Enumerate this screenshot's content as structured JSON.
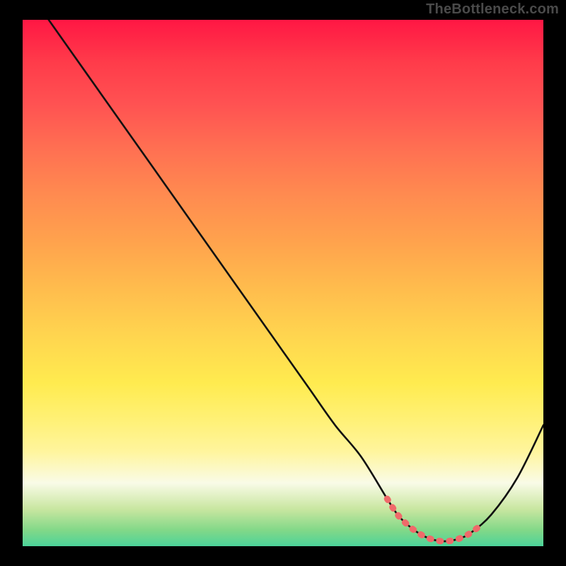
{
  "attribution": "TheBottleneck.com",
  "colors": {
    "background": "#000000",
    "watermark": "#4a4a4a",
    "curve": "#111111",
    "highlight": "#ef6a6a"
  },
  "chart_data": {
    "type": "line",
    "title": "",
    "xlabel": "",
    "ylabel": "",
    "xlim": [
      0,
      100
    ],
    "ylim": [
      0,
      100
    ],
    "grid": false,
    "series": [
      {
        "name": "bottleneck-curve",
        "x": [
          5,
          10,
          15,
          20,
          25,
          30,
          35,
          40,
          45,
          50,
          55,
          60,
          65,
          70,
          72,
          74,
          76,
          78,
          80,
          82,
          84,
          86,
          90,
          95,
          100
        ],
        "values": [
          100,
          93,
          86,
          79,
          72,
          65,
          58,
          51,
          44,
          37,
          30,
          23,
          17,
          9,
          6,
          4,
          2.5,
          1.5,
          1,
          1,
          1.5,
          2.5,
          6,
          13,
          23
        ]
      },
      {
        "name": "optimal-range-highlight",
        "x": [
          70,
          72,
          74,
          76,
          78,
          80,
          82,
          84,
          86,
          88
        ],
        "values": [
          9,
          6,
          4,
          2.5,
          1.5,
          1,
          1,
          1.5,
          2.5,
          4
        ]
      }
    ]
  }
}
